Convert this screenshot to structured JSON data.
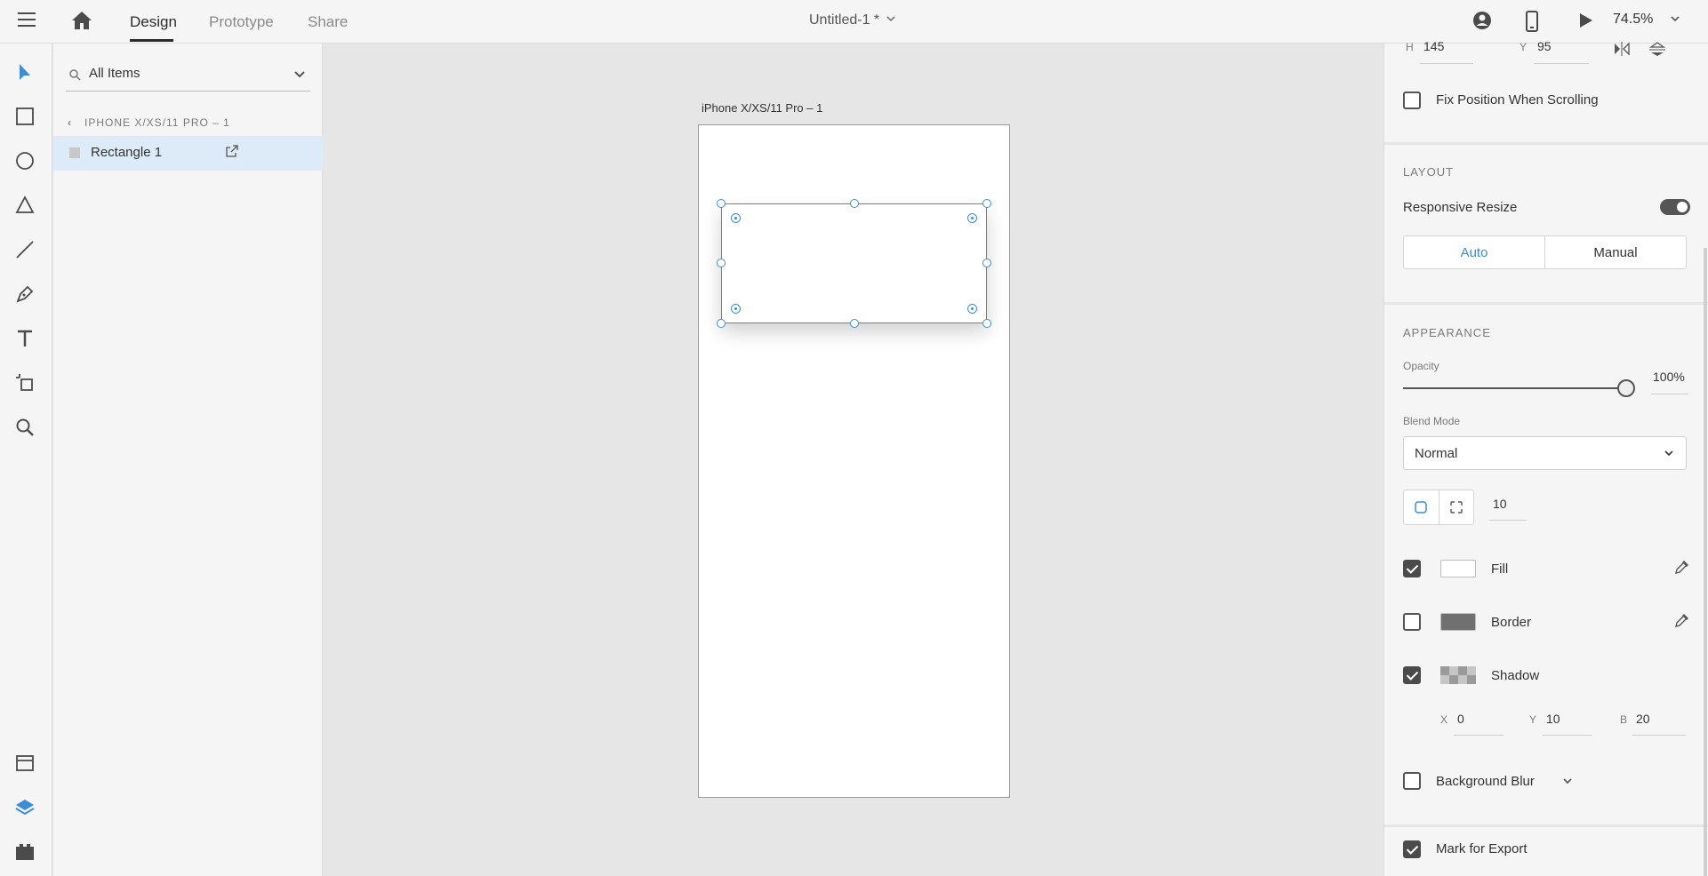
{
  "topbar": {
    "tabs": [
      "Design",
      "Prototype",
      "Share"
    ],
    "active_tab": "Design",
    "document_title": "Untitled-1 *",
    "zoom": "74.5%"
  },
  "layers": {
    "search_placeholder": "All Items",
    "breadcrumb": "IPHONE X/XS/11 PRO – 1",
    "items": [
      {
        "name": "Rectangle 1"
      }
    ]
  },
  "canvas": {
    "artboard_label": "iPhone X/XS/11 Pro – 1"
  },
  "props": {
    "h_label": "H",
    "h_value": "145",
    "y_label": "Y",
    "y_value": "95",
    "fix_position": "Fix Position When Scrolling",
    "layout_section": "LAYOUT",
    "responsive_resize": "Responsive Resize",
    "auto": "Auto",
    "manual": "Manual",
    "appearance_section": "APPEARANCE",
    "opacity_label": "Opacity",
    "opacity_value": "100%",
    "opacity_fraction": 1.0,
    "blend_label": "Blend Mode",
    "blend_value": "Normal",
    "corner_radius": "10",
    "fill": "Fill",
    "fill_color": "#ffffff",
    "border": "Border",
    "border_color": "#707070",
    "shadow": "Shadow",
    "shadow_x_label": "X",
    "shadow_x": "0",
    "shadow_y_label": "Y",
    "shadow_y": "10",
    "shadow_b_label": "B",
    "shadow_b": "20",
    "background_blur": "Background Blur",
    "mark_for_export": "Mark for Export"
  },
  "colors": {
    "accent": "#3a8dd6",
    "panel": "#f5f5f5",
    "canvas": "#e6e6e6",
    "selection_row": "#ddeaf7"
  }
}
